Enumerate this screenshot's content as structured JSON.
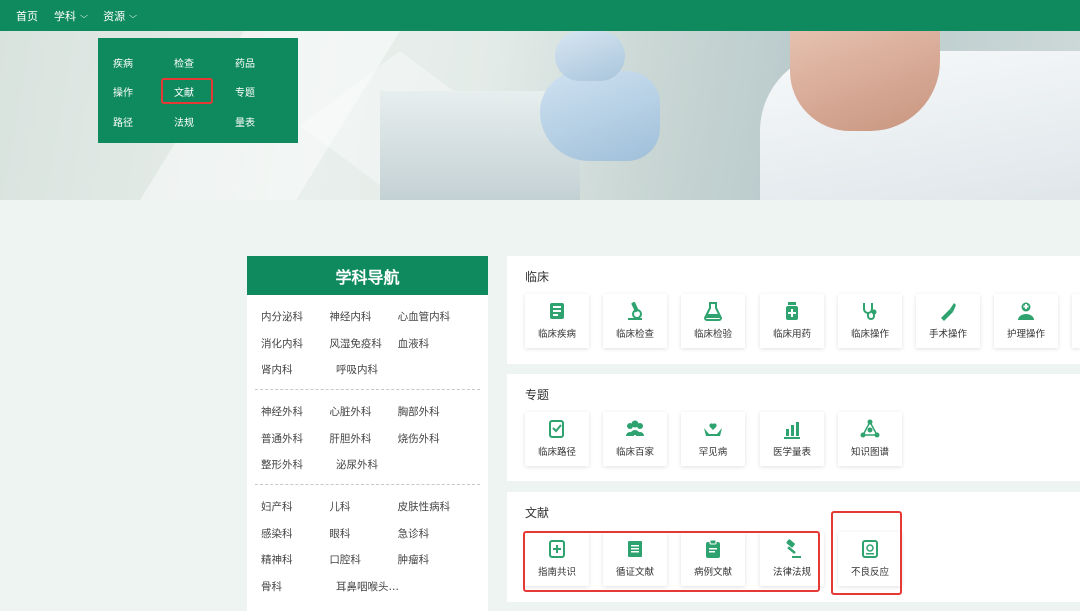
{
  "topnav": {
    "items": [
      {
        "label": "首页",
        "chevron": false
      },
      {
        "label": "学科",
        "chevron": true
      },
      {
        "label": "资源",
        "chevron": true
      }
    ],
    "chevron_glyph": "⌵"
  },
  "resource_menu": {
    "items": [
      "疾病",
      "检查",
      "药品",
      "操作",
      "文献",
      "专题",
      "路径",
      "法规",
      "量表"
    ],
    "highlighted": "文献"
  },
  "subject_nav": {
    "title": "学科导航",
    "groups": [
      [
        [
          "内分泌科",
          "神经内科",
          "心血管内科"
        ],
        [
          "消化内科",
          "风湿免疫科",
          "血液科"
        ],
        [
          "肾内科",
          "呼吸内科"
        ]
      ],
      [
        [
          "神经外科",
          "心脏外科",
          "胸部外科"
        ],
        [
          "普通外科",
          "肝胆外科",
          "烧伤外科"
        ],
        [
          "整形外科",
          "泌尿外科"
        ]
      ],
      [
        [
          "妇产科",
          "儿科",
          "皮肤性病科"
        ],
        [
          "感染科",
          "眼科",
          "急诊科"
        ],
        [
          "精神科",
          "口腔科",
          "肿瘤科"
        ],
        [
          "骨科",
          "耳鼻咽喉头…"
        ]
      ]
    ]
  },
  "sections": {
    "clinical": {
      "title": "临床",
      "tiles": [
        {
          "label": "临床疾病",
          "icon": "disease-book-icon"
        },
        {
          "label": "临床检查",
          "icon": "microscope-icon"
        },
        {
          "label": "临床检验",
          "icon": "flask-icon"
        },
        {
          "label": "临床用药",
          "icon": "medicine-bottle-icon"
        },
        {
          "label": "临床操作",
          "icon": "stethoscope-icon"
        },
        {
          "label": "手术操作",
          "icon": "scalpel-icon"
        },
        {
          "label": "护理操作",
          "icon": "nurse-icon"
        }
      ]
    },
    "topics": {
      "title": "专题",
      "tiles": [
        {
          "label": "临床路径",
          "icon": "pathway-doc-icon"
        },
        {
          "label": "临床百家",
          "icon": "people-group-icon"
        },
        {
          "label": "罕见病",
          "icon": "hands-heart-icon"
        },
        {
          "label": "医学量表",
          "icon": "bar-chart-icon"
        },
        {
          "label": "知识图谱",
          "icon": "knowledge-graph-icon"
        }
      ]
    },
    "literature": {
      "title": "文献",
      "tiles": [
        {
          "label": "指南共识",
          "icon": "guideline-doc-icon"
        },
        {
          "label": "循证文献",
          "icon": "evidence-book-icon"
        },
        {
          "label": "病例文献",
          "icon": "clipboard-icon"
        },
        {
          "label": "法律法规",
          "icon": "gavel-icon"
        },
        {
          "label": "不良反应",
          "icon": "adverse-reaction-icon"
        }
      ]
    }
  },
  "colors": {
    "brand": "#0f8a5f",
    "icon": "#2ea36f",
    "highlight": "#e53935"
  }
}
